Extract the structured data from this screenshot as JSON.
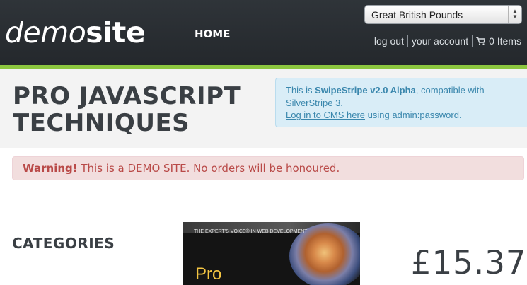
{
  "header": {
    "logo": {
      "light": "demo",
      "bold": "site"
    },
    "nav": {
      "home": "HOME"
    },
    "currency": {
      "selected": "Great British Pounds"
    },
    "user_links": {
      "logout": "log out",
      "account": "your account",
      "cart": "0 Items"
    },
    "colors": {
      "accent": "#8cc63f",
      "header_bg": "#2b3035"
    }
  },
  "title_band": {
    "title_line1": "PRO JAVASCRIPT",
    "title_line2": "TECHNIQUES"
  },
  "info_box": {
    "prefix": "This is ",
    "product": "SwipeStripe v2.0 Alpha",
    "middle": ", compatible with SilverStripe 3.",
    "login_link": "Log in to CMS here",
    "suffix": " using admin:password."
  },
  "warning": {
    "strong": "Warning!",
    "text": " This is a DEMO SITE. No orders will be honoured."
  },
  "content": {
    "categories_heading": "CATEGORIES",
    "book": {
      "tagline": "THE EXPERT'S VOICE® IN WEB DEVELOPMENT",
      "title_fragment": "Pro"
    },
    "price": "£15.37"
  },
  "icons": [
    "cart-icon",
    "select-arrows-icon"
  ]
}
